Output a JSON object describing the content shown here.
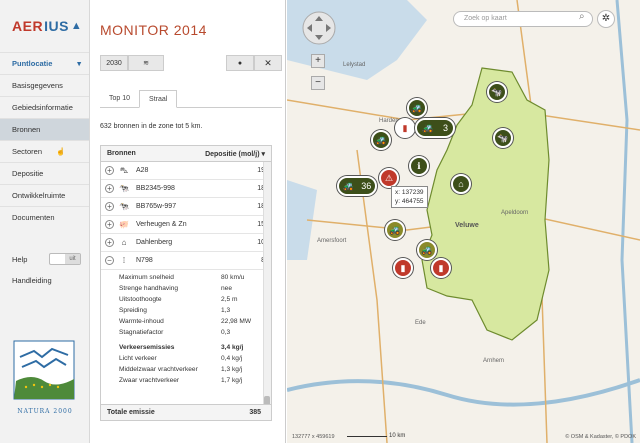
{
  "app": {
    "logo_left": "AER",
    "logo_mid": "IUS",
    "title": "MONITOR 2014"
  },
  "nav": {
    "primary": "Puntlocatie",
    "items": [
      "Basisgegevens",
      "Gebiedsinformatie",
      "Bronnen",
      "Sectoren",
      "Depositie",
      "Ontwikkelruimte",
      "Documenten"
    ],
    "active": "Bronnen",
    "help": "Help",
    "help_toggle": "uit",
    "handleiding": "Handleiding",
    "natura": "NATURA 2000"
  },
  "toolbar": {
    "year": "2030"
  },
  "tabs": [
    "Top 10",
    "Straal"
  ],
  "active_tab": "Straal",
  "summary": "632 bronnen in de zone tot 5 km.",
  "table": {
    "col_source": "Bronnen",
    "col_dep": "Depositie (mol/j)",
    "rows": [
      {
        "icon": "road-icon",
        "glyph": "⛍",
        "name": "A28",
        "value": "19"
      },
      {
        "icon": "cow-icon",
        "glyph": "🐄",
        "name": "BB2345-998",
        "value": "18"
      },
      {
        "icon": "cow-icon",
        "glyph": "🐄",
        "name": "BB765w-997",
        "value": "18"
      },
      {
        "icon": "pig-icon",
        "glyph": "🐖",
        "name": "Verheugen & Zn",
        "value": "15"
      },
      {
        "icon": "house-icon",
        "glyph": "⌂",
        "name": "Dahlenberg",
        "value": "10"
      },
      {
        "icon": "road-icon",
        "glyph": "⁞",
        "name": "N798",
        "value": "8"
      }
    ],
    "details": [
      {
        "k": "Maximum snelheid",
        "v": "80 km/u"
      },
      {
        "k": "Strenge handhaving",
        "v": "nee"
      },
      {
        "k": "Uitstoothoogte",
        "v": "2,5 m"
      },
      {
        "k": "Spreiding",
        "v": "1,3"
      },
      {
        "k": "Warmte-inhoud",
        "v": "22,98 MW"
      },
      {
        "k": "Stagnatiefactor",
        "v": "0,3"
      }
    ],
    "emissions_header": {
      "k": "Verkeersemissies",
      "v": "3,4 kg/j"
    },
    "emissions": [
      {
        "k": "Licht verkeer",
        "v": "0,4 kg/j"
      },
      {
        "k": "Middelzwaar vrachtverkeer",
        "v": "1,3 kg/j"
      },
      {
        "k": "Zwaar vrachtverkeer",
        "v": "1,7 kg/j"
      }
    ],
    "total_label": "Totale emissie",
    "total_value": "385"
  },
  "map": {
    "search_placeholder": "Zoek op kaart",
    "coords_x": "x: 137239",
    "coords_y": "y: 464755",
    "label_veluwe": "Veluwe",
    "places": [
      "Lelystad",
      "Amersfoort",
      "Apeldoorn",
      "Arnhem",
      "Ede",
      "Harderwijk"
    ],
    "attribution": "© OSM & Kadaster, © PDOK",
    "scale": "10 km",
    "pointer": "132777 x 459619",
    "cluster_a": "36",
    "cluster_b": "3",
    "colors": {
      "veluwe": "#d7e8a0",
      "veluwe_border": "#6e8b2e",
      "marker_dark": "#3d4f1a",
      "marker_red": "#c0392b",
      "marker_olive": "#8a8a2a"
    }
  }
}
